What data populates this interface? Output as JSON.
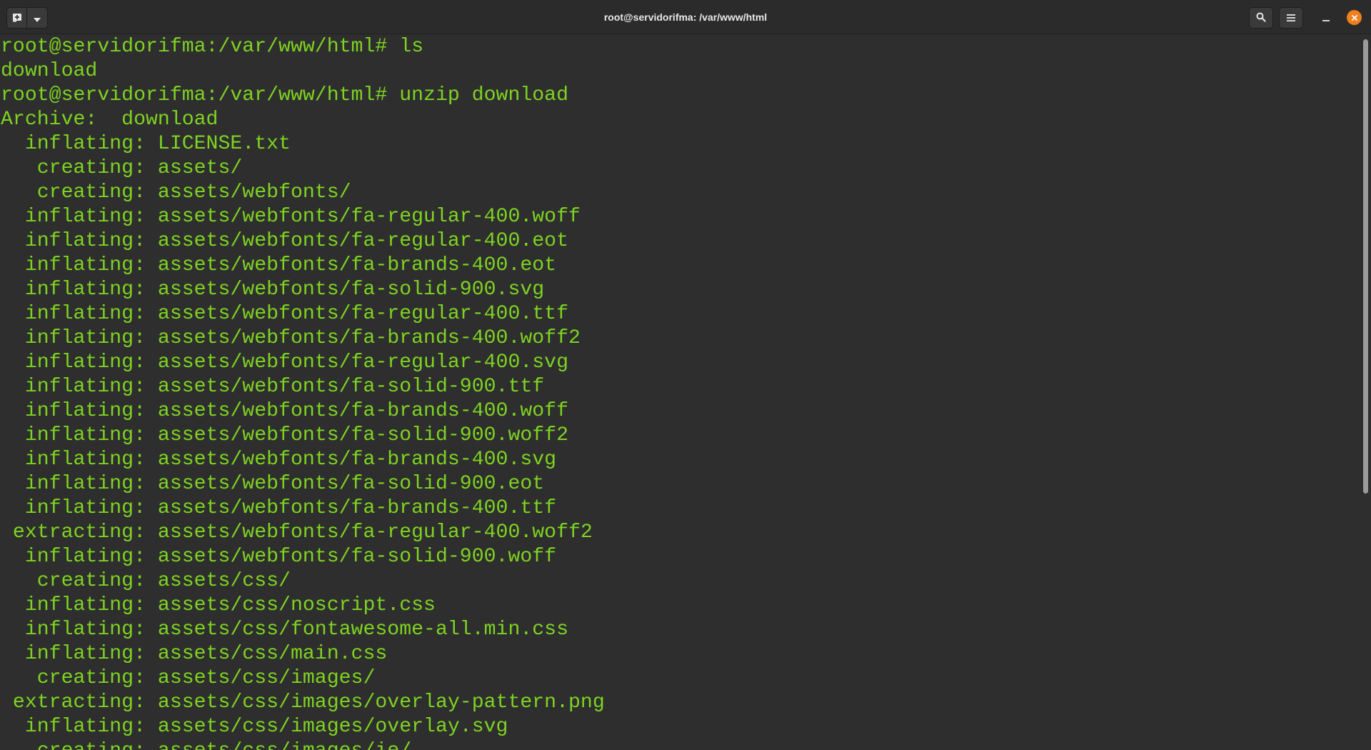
{
  "window": {
    "title": "root@servidorifma: /var/www/html"
  },
  "titlebar": {
    "new_tab_icon": "new-tab-icon",
    "tab_menu_icon": "chevron-down-icon",
    "search_icon": "search-icon",
    "menu_icon": "hamburger-menu-icon",
    "minimize_icon": "minimize-icon",
    "close_icon": "close-icon"
  },
  "colors": {
    "terminal_background": "#2e2e2e",
    "terminal_text": "#7ed321",
    "close_button": "#f07f1e"
  },
  "terminal": {
    "lines": [
      "root@servidorifma:/var/www/html# ls",
      "download",
      "root@servidorifma:/var/www/html# unzip download",
      "Archive:  download",
      "  inflating: LICENSE.txt",
      "   creating: assets/",
      "   creating: assets/webfonts/",
      "  inflating: assets/webfonts/fa-regular-400.woff",
      "  inflating: assets/webfonts/fa-regular-400.eot",
      "  inflating: assets/webfonts/fa-brands-400.eot",
      "  inflating: assets/webfonts/fa-solid-900.svg",
      "  inflating: assets/webfonts/fa-regular-400.ttf",
      "  inflating: assets/webfonts/fa-brands-400.woff2",
      "  inflating: assets/webfonts/fa-regular-400.svg",
      "  inflating: assets/webfonts/fa-solid-900.ttf",
      "  inflating: assets/webfonts/fa-brands-400.woff",
      "  inflating: assets/webfonts/fa-solid-900.woff2",
      "  inflating: assets/webfonts/fa-brands-400.svg",
      "  inflating: assets/webfonts/fa-solid-900.eot",
      "  inflating: assets/webfonts/fa-brands-400.ttf",
      " extracting: assets/webfonts/fa-regular-400.woff2",
      "  inflating: assets/webfonts/fa-solid-900.woff",
      "   creating: assets/css/",
      "  inflating: assets/css/noscript.css",
      "  inflating: assets/css/fontawesome-all.min.css",
      "  inflating: assets/css/main.css",
      "   creating: assets/css/images/",
      " extracting: assets/css/images/overlay-pattern.png",
      "  inflating: assets/css/images/overlay.svg",
      "   creating: assets/css/images/ie/"
    ]
  }
}
